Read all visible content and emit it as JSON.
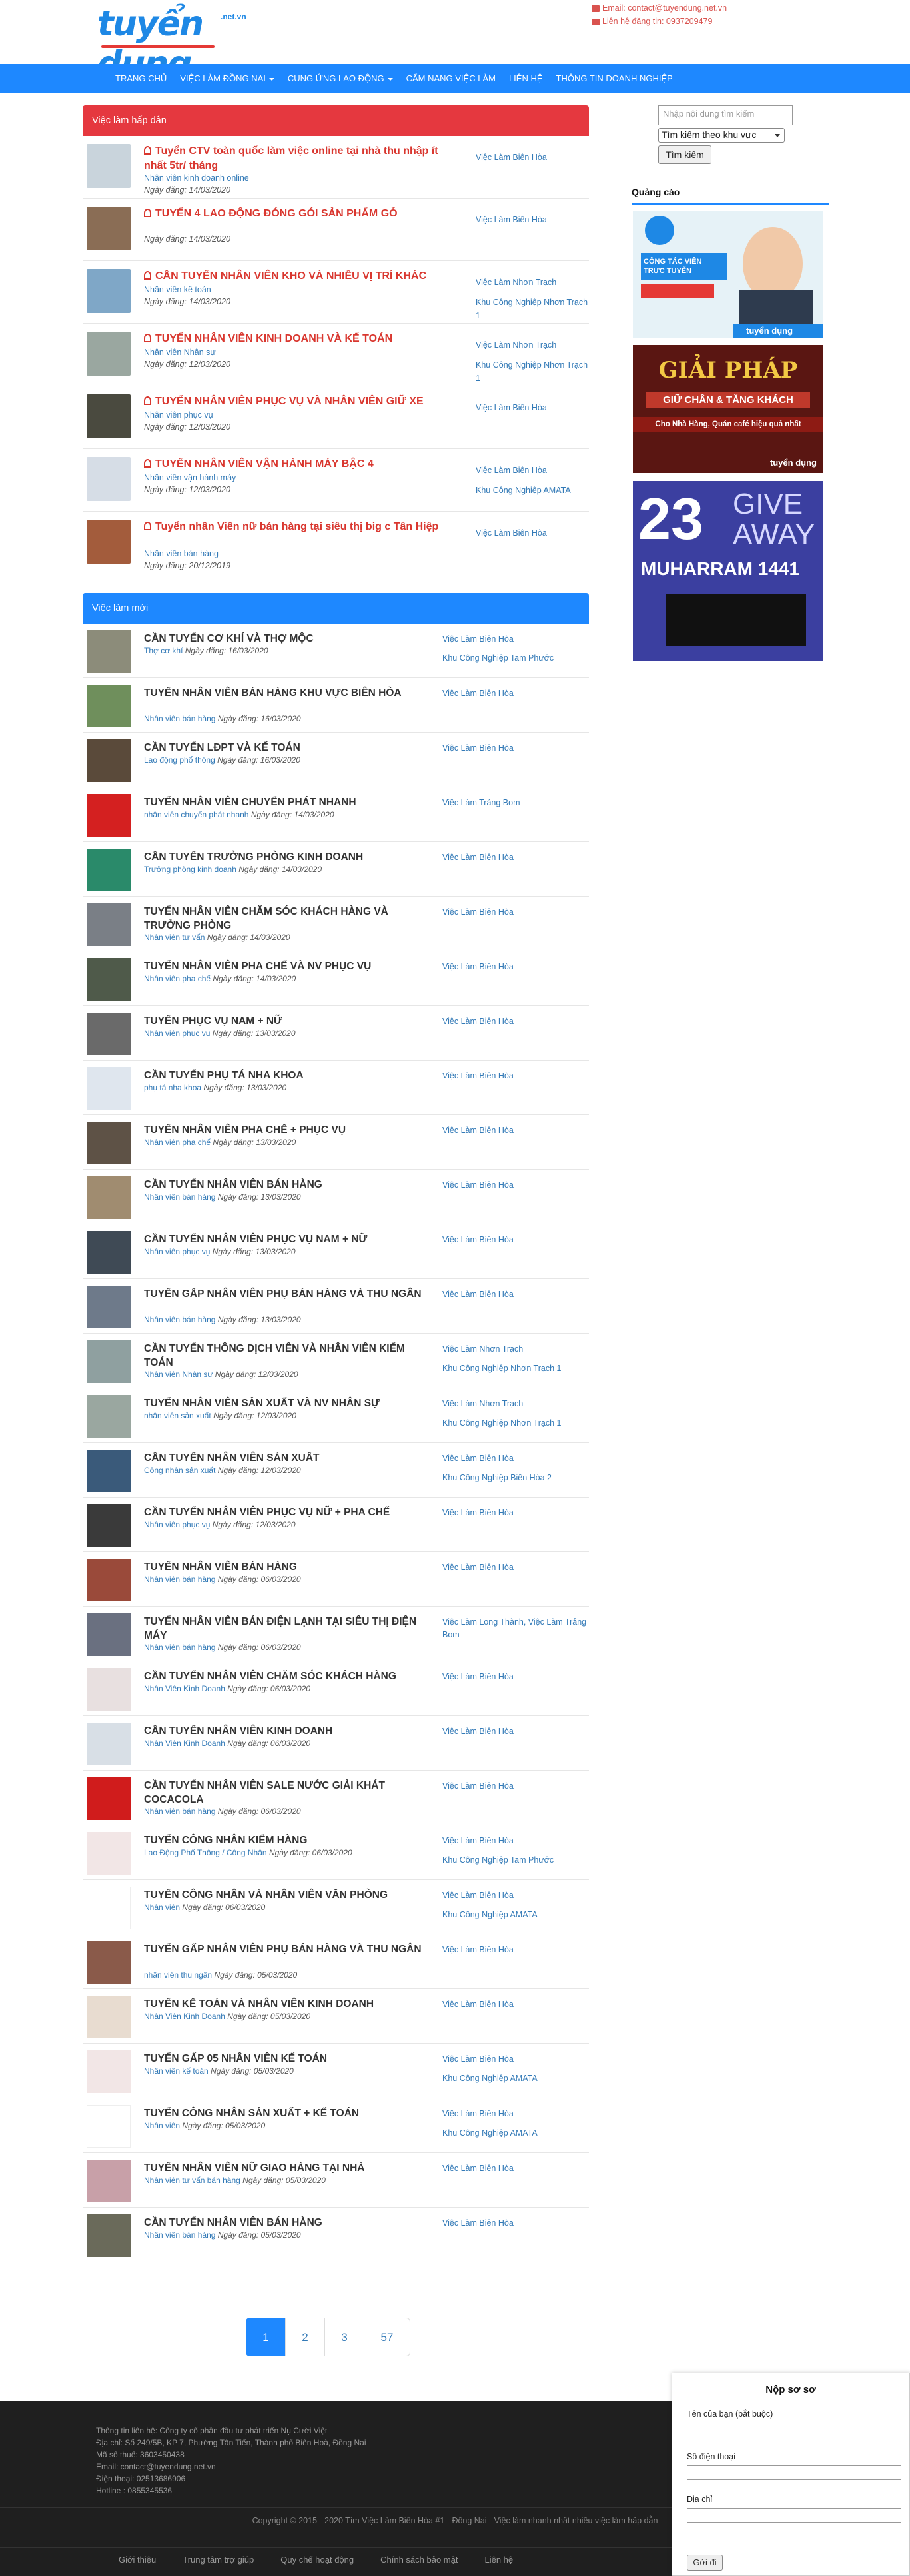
{
  "header": {
    "logo_text": "tuyển dụng",
    "logo_suffix": ".net.vn",
    "email": "Email: contact@tuyendung.net.vn",
    "phone": "Liên hệ đăng tin: 0937209479"
  },
  "nav": [
    {
      "label": "TRANG CHỦ",
      "dropdown": false
    },
    {
      "label": "VIỆC LÀM ĐỒNG NAI",
      "dropdown": true
    },
    {
      "label": "CUNG ỨNG LAO ĐỘNG",
      "dropdown": true
    },
    {
      "label": "CẨM NANG VIỆC LÀM",
      "dropdown": false
    },
    {
      "label": "LIÊN HỆ",
      "dropdown": false
    },
    {
      "label": "THÔNG TIN DOANH NGHIỆP",
      "dropdown": false
    }
  ],
  "hot": {
    "title": "Việc làm hấp dẫn",
    "items": [
      {
        "title": "Tuyển CTV toàn quốc làm việc online tại nhà thu nhập ít nhất 5tr/ tháng",
        "category": "Nhân viên kinh doanh online",
        "date": "Ngày đăng: 14/03/2020",
        "locations": [
          "Việc Làm Biên Hòa"
        ],
        "thumb": "#c9d4dc"
      },
      {
        "title": "TUYỂN 4 LAO ĐỘNG ĐÓNG GÓI SẢN PHẨM GỖ",
        "category": "",
        "date": "Ngày đăng: 14/03/2020",
        "locations": [
          "Việc Làm Biên Hòa"
        ],
        "thumb": "#8a6d55"
      },
      {
        "title": "CẦN TUYỂN NHÂN VIÊN KHO VÀ NHIỀU VỊ TRÍ KHÁC",
        "category": "Nhân viên kế toán",
        "date": "Ngày đăng: 14/03/2020",
        "locations": [
          "Việc Làm Nhơn Trạch",
          "Khu Công Nghiệp Nhơn Trạch 1"
        ],
        "thumb": "#7fa7c7"
      },
      {
        "title": "TUYỂN NHÂN VIÊN KINH DOANH VÀ KẾ TOÁN",
        "category": "Nhân viên Nhân sự",
        "date": "Ngày đăng: 12/03/2020",
        "locations": [
          "Việc Làm Nhơn Trạch",
          "Khu Công Nghiệp Nhơn Trạch 1"
        ],
        "thumb": "#9aa7a0"
      },
      {
        "title": "TUYỂN NHÂN VIÊN PHỤC VỤ VÀ NHÂN VIÊN GIỮ XE",
        "category": "Nhân viên phục vụ",
        "date": "Ngày đăng: 12/03/2020",
        "locations": [
          "Việc Làm Biên Hòa"
        ],
        "thumb": "#4a4a3f"
      },
      {
        "title": "TUYỂN NHÂN VIÊN VẬN HÀNH MÁY BẬC 4",
        "category": "Nhân viên vận hành máy",
        "date": "Ngày đăng: 12/03/2020",
        "locations": [
          "Việc Làm Biên Hòa",
          "Khu Công Nghiệp AMATA"
        ],
        "thumb": "#d6dde6"
      },
      {
        "title": "Tuyển nhân Viên nữ bán hàng tại siêu thị big c Tân Hiệp",
        "category": "Nhân viên bán hàng",
        "date": "Ngày đăng: 20/12/2019",
        "locations": [
          "Việc Làm Biên Hòa"
        ],
        "thumb": "#a35c3c"
      }
    ]
  },
  "latest": {
    "title": "Việc làm mới",
    "items": [
      {
        "title": "CẦN TUYỂN CƠ KHÍ VÀ THỢ MỘC",
        "category": "Thợ cơ khí",
        "date": "Ngày đăng: 16/03/2020",
        "locations": [
          "Việc Làm Biên Hòa",
          "Khu Công Nghiệp Tam Phước"
        ],
        "thumb": "#8c8c7a"
      },
      {
        "title": "TUYỂN NHÂN VIÊN BÁN HÀNG KHU VỰC BIÊN HÒA",
        "category": "Nhân viên bán hàng",
        "date": "Ngày đăng: 16/03/2020",
        "locations": [
          "Việc Làm Biên Hòa"
        ],
        "thumb": "#6f8f5c"
      },
      {
        "title": "CẦN TUYỂN LĐPT VÀ KẾ TOÁN",
        "category": "Lao động phổ thông",
        "date": "Ngày đăng: 16/03/2020",
        "locations": [
          "Việc Làm Biên Hòa"
        ],
        "thumb": "#5a4a3a"
      },
      {
        "title": "TUYỂN NHÂN VIÊN CHUYỂN PHÁT NHANH",
        "category": "nhân viên chuyển phát nhanh",
        "date": "Ngày đăng: 14/03/2020",
        "locations": [
          "Việc Làm Trảng Bom"
        ],
        "thumb": "#d42020"
      },
      {
        "title": "CẦN TUYỂN TRƯỞNG PHÒNG KINH DOANH",
        "category": "Trưởng phòng kinh doanh",
        "date": "Ngày đăng: 14/03/2020",
        "locations": [
          "Việc Làm Biên Hòa"
        ],
        "thumb": "#2a8a6a"
      },
      {
        "title": "TUYỂN NHÂN VIÊN CHĂM SÓC KHÁCH HÀNG VÀ TRƯỞNG PHÒNG",
        "category": "Nhân viên tư vấn",
        "date": "Ngày đăng: 14/03/2020",
        "locations": [
          "Việc Làm Biên Hòa"
        ],
        "thumb": "#7a7f86"
      },
      {
        "title": "TUYỂN NHÂN VIÊN PHA CHẾ VÀ NV PHỤC VỤ",
        "category": "Nhân viên pha chế",
        "date": "Ngày đăng: 14/03/2020",
        "locations": [
          "Việc Làm Biên Hòa"
        ],
        "thumb": "#4f5a4a"
      },
      {
        "title": "TUYỂN PHỤC VỤ NAM + NỮ",
        "category": "Nhân viên phục vụ",
        "date": "Ngày đăng: 13/03/2020",
        "locations": [
          "Việc Làm Biên Hòa"
        ],
        "thumb": "#6a6a6a"
      },
      {
        "title": "CẦN TUYỂN PHỤ TÁ NHA KHOA",
        "category": "phụ tá nha khoa",
        "date": "Ngày đăng: 13/03/2020",
        "locations": [
          "Việc Làm Biên Hòa"
        ],
        "thumb": "#dfe6ee"
      },
      {
        "title": "TUYỂN NHÂN VIÊN PHA CHẾ + PHỤC VỤ",
        "category": "Nhân viên pha chế",
        "date": "Ngày đăng: 13/03/2020",
        "locations": [
          "Việc Làm Biên Hòa"
        ],
        "thumb": "#5e5246"
      },
      {
        "title": "CẦN TUYỂN NHÂN VIÊN BÁN HÀNG",
        "category": "Nhân viên bán hàng",
        "date": "Ngày đăng: 13/03/2020",
        "locations": [
          "Việc Làm Biên Hòa"
        ],
        "thumb": "#a08c70"
      },
      {
        "title": "CẦN TUYỂN NHÂN VIÊN PHỤC VỤ NAM + NỮ",
        "category": "Nhân viên phục vụ",
        "date": "Ngày đăng: 13/03/2020",
        "locations": [
          "Việc Làm Biên Hòa"
        ],
        "thumb": "#3f4a55"
      },
      {
        "title": "TUYỂN GẤP NHÂN VIÊN PHỤ BÁN HÀNG VÀ THU NGÂN",
        "category": "Nhân viên bán hàng",
        "date": "Ngày đăng: 13/03/2020",
        "locations": [
          "Việc Làm Biên Hòa"
        ],
        "thumb": "#6e7a8a"
      },
      {
        "title": "CẦN TUYỂN THÔNG DỊCH VIÊN VÀ NHÂN VIÊN KIỂM TOÁN",
        "category": "Nhân viên Nhân sự",
        "date": "Ngày đăng: 12/03/2020",
        "locations": [
          "Việc Làm Nhơn Trạch",
          "Khu Công Nghiệp Nhơn Trạch 1"
        ],
        "thumb": "#8fa0a0"
      },
      {
        "title": "TUYỂN NHÂN VIÊN SẢN XUẤT VÀ NV NHÂN SỰ",
        "category": "nhân viên sản xuất",
        "date": "Ngày đăng: 12/03/2020",
        "locations": [
          "Việc Làm Nhơn Trạch",
          "Khu Công Nghiệp Nhơn Trạch 1"
        ],
        "thumb": "#9aa7a0"
      },
      {
        "title": "CẦN TUYỂN NHÂN VIÊN SẢN XUẤT",
        "category": "Công nhân sản xuất",
        "date": "Ngày đăng: 12/03/2020",
        "locations": [
          "Việc Làm Biên Hòa",
          "Khu Công Nghiệp Biên Hòa 2"
        ],
        "thumb": "#3a5a7a"
      },
      {
        "title": "CẦN TUYỂN NHÂN VIÊN PHỤC VỤ NỮ + PHA CHẾ",
        "category": "Nhân viên phục vụ",
        "date": "Ngày đăng: 12/03/2020",
        "locations": [
          "Việc Làm Biên Hòa"
        ],
        "thumb": "#3a3a3a"
      },
      {
        "title": "TUYỂN NHÂN VIÊN BÁN HÀNG",
        "category": "Nhân viên bán hàng",
        "date": "Ngày đăng: 06/03/2020",
        "locations": [
          "Việc Làm Biên Hòa"
        ],
        "thumb": "#9a4a3a"
      },
      {
        "title": "TUYỂN NHÂN VIÊN BÁN ĐIỆN LẠNH TẠI SIÊU THỊ ĐIỆN MÁY",
        "category": "Nhân viên bán hàng",
        "date": "Ngày đăng: 06/03/2020",
        "locations": [
          "Việc Làm Long Thành, Việc Làm Trảng Bom"
        ],
        "thumb": "#6a7080"
      },
      {
        "title": "CẦN TUYỂN NHÂN VIÊN CHĂM SÓC KHÁCH HÀNG",
        "category": "Nhân Viên Kinh Doanh",
        "date": "Ngày đăng: 06/03/2020",
        "locations": [
          "Việc Làm Biên Hòa"
        ],
        "thumb": "#e8e0e0"
      },
      {
        "title": "CẦN TUYỂN NHÂN VIÊN KINH DOANH",
        "category": "Nhân Viên Kinh Doanh",
        "date": "Ngày đăng: 06/03/2020",
        "locations": [
          "Việc Làm Biên Hòa"
        ],
        "thumb": "#d8dfe6"
      },
      {
        "title": "CẦN TUYỂN NHÂN VIÊN SALE NƯỚC GIẢI KHÁT COCACOLA",
        "category": "Nhân viên bán hàng",
        "date": "Ngày đăng: 06/03/2020",
        "locations": [
          "Việc Làm Biên Hòa"
        ],
        "thumb": "#d01c1c"
      },
      {
        "title": "TUYỂN CÔNG NHÂN KIỂM HÀNG",
        "category": "Lao Động Phổ Thông / Công Nhân",
        "date": "Ngày đăng: 06/03/2020",
        "locations": [
          "Việc Làm Biên Hòa",
          "Khu Công Nghiệp Tam Phước"
        ],
        "thumb": "#f2e6e6"
      },
      {
        "title": "TUYỂN CÔNG NHÂN VÀ NHÂN VIÊN VĂN PHÒNG",
        "category": "Nhân viên",
        "date": "Ngày đăng: 06/03/2020",
        "locations": [
          "Việc Làm Biên Hòa",
          "Khu Công Nghiệp AMATA"
        ],
        "thumb": "#ffffff"
      },
      {
        "title": "TUYỂN GẤP NHÂN VIÊN PHỤ BÁN HÀNG VÀ THU NGÂN",
        "category": "nhân viên thu ngân",
        "date": "Ngày đăng: 05/03/2020",
        "locations": [
          "Việc Làm Biên Hòa"
        ],
        "thumb": "#8a5a4a"
      },
      {
        "title": "TUYỂN KẾ TOÁN VÀ NHÂN VIÊN KINH DOANH",
        "category": "Nhân Viên Kinh Doanh",
        "date": "Ngày đăng: 05/03/2020",
        "locations": [
          "Việc Làm Biên Hòa"
        ],
        "thumb": "#e8dcd0"
      },
      {
        "title": "TUYỂN GẤP 05 NHÂN VIÊN KẾ TOÁN",
        "category": "Nhân viên kế toán",
        "date": "Ngày đăng: 05/03/2020",
        "locations": [
          "Việc Làm Biên Hòa",
          "Khu Công Nghiệp AMATA"
        ],
        "thumb": "#f2e6e6"
      },
      {
        "title": "TUYỂN CÔNG NHÂN SẢN XUẤT + KẾ TOÁN",
        "category": "Nhân viên",
        "date": "Ngày đăng: 05/03/2020",
        "locations": [
          "Việc Làm Biên Hòa",
          "Khu Công Nghiệp AMATA"
        ],
        "thumb": "#ffffff"
      },
      {
        "title": "TUYỂN NHÂN VIÊN NỮ GIAO HÀNG TẠI NHÀ",
        "category": "Nhân viên tư vấn bán hàng",
        "date": "Ngày đăng: 05/03/2020",
        "locations": [
          "Việc Làm Biên Hòa"
        ],
        "thumb": "#c8a0a8"
      },
      {
        "title": "CẦN TUYỂN NHÂN VIÊN BÁN HÀNG",
        "category": "Nhân viên bán hàng",
        "date": "Ngày đăng: 05/03/2020",
        "locations": [
          "Việc Làm Biên Hòa"
        ],
        "thumb": "#6a6a5a"
      }
    ]
  },
  "pagination": [
    "1",
    "2",
    "3",
    "57"
  ],
  "sidebar": {
    "search_placeholder": "Nhập nội dung tìm kiếm",
    "area_select": "Tìm kiếm theo khu vực",
    "search_button": "Tìm kiếm",
    "ads_title": "Quảng cáo",
    "ad1": {
      "line1": "CÔNG TÁC VIÊN TRỰC TUYẾN",
      "line2": "tuyển dụng"
    },
    "ad2": {
      "line1": "GIẢI PHÁP",
      "line2": "GIỮ CHÂN & TĂNG KHÁCH",
      "line3": "Cho Nhà Hàng, Quán café hiệu quả nhất",
      "brand": "tuyển dụng"
    },
    "ad3": {
      "number": "23",
      "word1": "GIVE",
      "word2": "AWAY",
      "word3": "MUHARRAM 1441"
    }
  },
  "footer": {
    "lines": [
      "Thông tin liên hệ: Công ty cổ phần đầu tư phát triển Nụ Cười Việt",
      "Địa chỉ: Số 249/5B, KP 7, Phường Tân Tiến, Thành phố Biên Hoà, Đồng Nai",
      "Mã số thuế: 3603450438",
      "Email: contact@tuyendung.net.vn",
      "Điện thoại: 02513686906",
      "Hotline : 0855345536"
    ],
    "copyright": "Copyright © 2015 - 2020 Tìm Việc Làm Biên Hòa #1 - Đồng Nai - Việc làm nhanh nhất nhiều việc làm hấp dẫn",
    "links": [
      "Giới thiệu",
      "Trung tâm trợ giúp",
      "Quy chế hoạt động",
      "Chính sách bảo mật",
      "Liên hệ"
    ]
  },
  "cv_form": {
    "title": "Nộp sơ sơ",
    "name_label": "Tên của bạn (bắt buộc)",
    "phone_label": "Số điện thoại",
    "address_label": "Địa chỉ",
    "submit": "Gởi đi"
  }
}
